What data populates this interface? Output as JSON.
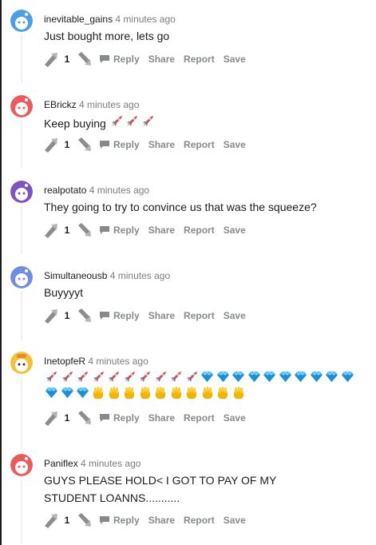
{
  "comments": [
    {
      "username": "inevitable_gains",
      "time": "4 minutes ago",
      "text": "Just bought more, lets go",
      "votes": "1",
      "avatar_color": "#4b9fe8"
    },
    {
      "username": "EBrickz",
      "time": "4 minutes ago",
      "text": "Keep buying",
      "emojis": [
        "rocket",
        "rocket",
        "rocket"
      ],
      "votes": "1",
      "avatar_color": "#ea5b5b"
    },
    {
      "username": "realpotato",
      "time": "4 minutes ago",
      "text": "They going to try to convince us that was the squeeze?",
      "votes": "1",
      "avatar_color": "#7e53c1"
    },
    {
      "username": "Simultaneousb",
      "time": "4 minutes ago",
      "text": "Buyyyyt",
      "votes": "1",
      "avatar_color": "#6f8de5"
    },
    {
      "username": "InetopfeR",
      "time": "4 minutes ago",
      "emoji_line1": "10 rockets, 10 diamonds",
      "emoji_line2": "3 diamonds, 9 hands",
      "votes": "1",
      "avatar_color": "#f5c13a"
    },
    {
      "username": "Paniflex",
      "time": "4 minutes ago",
      "text": "GUYS PLEASE HOLD< I GOT TO PAY OF MY STUDENT LOANNS...........",
      "votes": "1",
      "avatar_color": "#ea5b5b"
    }
  ],
  "actions": {
    "reply": "Reply",
    "share": "Share",
    "report": "Report",
    "save": "Save"
  },
  "icons": {
    "upvote": "upvote-arrow-icon",
    "downvote": "downvote-arrow-icon",
    "reply": "comment-bubble-icon"
  }
}
